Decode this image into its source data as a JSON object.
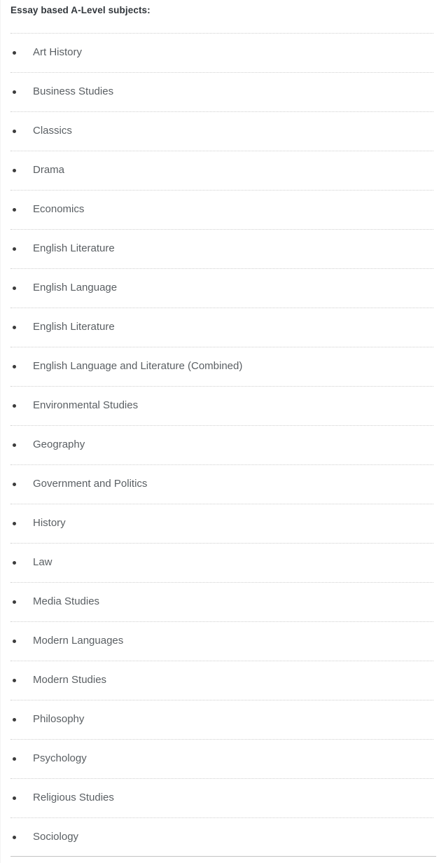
{
  "heading": "Essay based A-Level subjects:",
  "colors": {
    "background": "#ffffff",
    "heading_text": "#32373c",
    "item_text": "#5a5f63",
    "bullet": "#3c3c3c",
    "divider_dotted": "#cfcfcf",
    "divider_solid": "#c3c3c3"
  },
  "list": {
    "items": [
      {
        "label": "Art History"
      },
      {
        "label": "Business Studies"
      },
      {
        "label": "Classics"
      },
      {
        "label": "Drama"
      },
      {
        "label": "Economics"
      },
      {
        "label": "English Literature"
      },
      {
        "label": "English Language"
      },
      {
        "label": "English Literature"
      },
      {
        "label": "English Language and Literature (Combined)"
      },
      {
        "label": "Environmental Studies"
      },
      {
        "label": "Geography"
      },
      {
        "label": "Government and Politics"
      },
      {
        "label": "History"
      },
      {
        "label": "Law"
      },
      {
        "label": "Media Studies"
      },
      {
        "label": "Modern Languages"
      },
      {
        "label": "Modern Studies"
      },
      {
        "label": "Philosophy"
      },
      {
        "label": "Psychology"
      },
      {
        "label": "Religious Studies"
      },
      {
        "label": "Sociology"
      }
    ]
  }
}
